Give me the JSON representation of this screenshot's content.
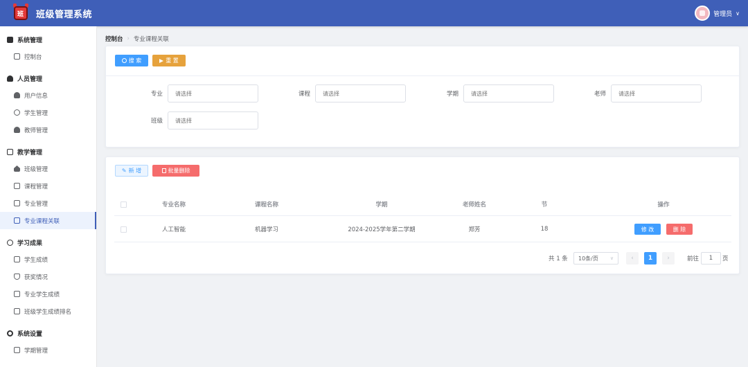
{
  "header": {
    "logo_char": "班",
    "app_title": "班级管理系统",
    "user_name": "管理员",
    "user_caret": "∨"
  },
  "sidebar": {
    "groups": [
      {
        "label": "系统管理",
        "items": [
          {
            "label": "控制台"
          }
        ]
      },
      {
        "label": "人员管理",
        "items": [
          {
            "label": "用户信息"
          },
          {
            "label": "学生管理"
          },
          {
            "label": "教师管理"
          }
        ]
      },
      {
        "label": "教学管理",
        "items": [
          {
            "label": "班级管理"
          },
          {
            "label": "课程管理"
          },
          {
            "label": "专业管理"
          },
          {
            "label": "专业课程关联"
          }
        ]
      },
      {
        "label": "学习成果",
        "items": [
          {
            "label": "学生成绩"
          },
          {
            "label": "获奖情况"
          },
          {
            "label": "专业学生成绩"
          },
          {
            "label": "班级学生成绩排名"
          }
        ]
      },
      {
        "label": "系统设置",
        "items": [
          {
            "label": "学期管理"
          }
        ]
      }
    ]
  },
  "breadcrumb": {
    "root": "控制台",
    "sep": "›",
    "current": "专业课程关联"
  },
  "search": {
    "search_label": "搜 索",
    "reset_label": "重 置",
    "fields": [
      {
        "label": "专业",
        "placeholder": "请选择"
      },
      {
        "label": "课程",
        "placeholder": "请选择"
      },
      {
        "label": "学期",
        "placeholder": "请选择"
      },
      {
        "label": "老师",
        "placeholder": "请选择"
      },
      {
        "label": "班级",
        "placeholder": "请选择"
      }
    ]
  },
  "toolbar": {
    "add_label": "新 增",
    "batch_delete_label": "批量删除"
  },
  "table": {
    "columns": [
      "专业名称",
      "课程名称",
      "学期",
      "老师姓名",
      "节",
      "操作"
    ],
    "rows": [
      {
        "major": "人工智能",
        "course": "机器学习",
        "term": "2024-2025学年第二学期",
        "teacher": "郑芳",
        "section": "18",
        "edit_label": "修 改",
        "delete_label": "删 除"
      }
    ]
  },
  "pagination": {
    "total_text": "共 1 条",
    "page_size": "10条/页",
    "current_page": "1",
    "goto_label": "前往",
    "goto_value": "1",
    "page_unit": "页"
  },
  "colors": {
    "header": "#3f5fb8",
    "primary": "#409eff",
    "warning": "#e6a23c",
    "danger": "#f56c6c"
  }
}
